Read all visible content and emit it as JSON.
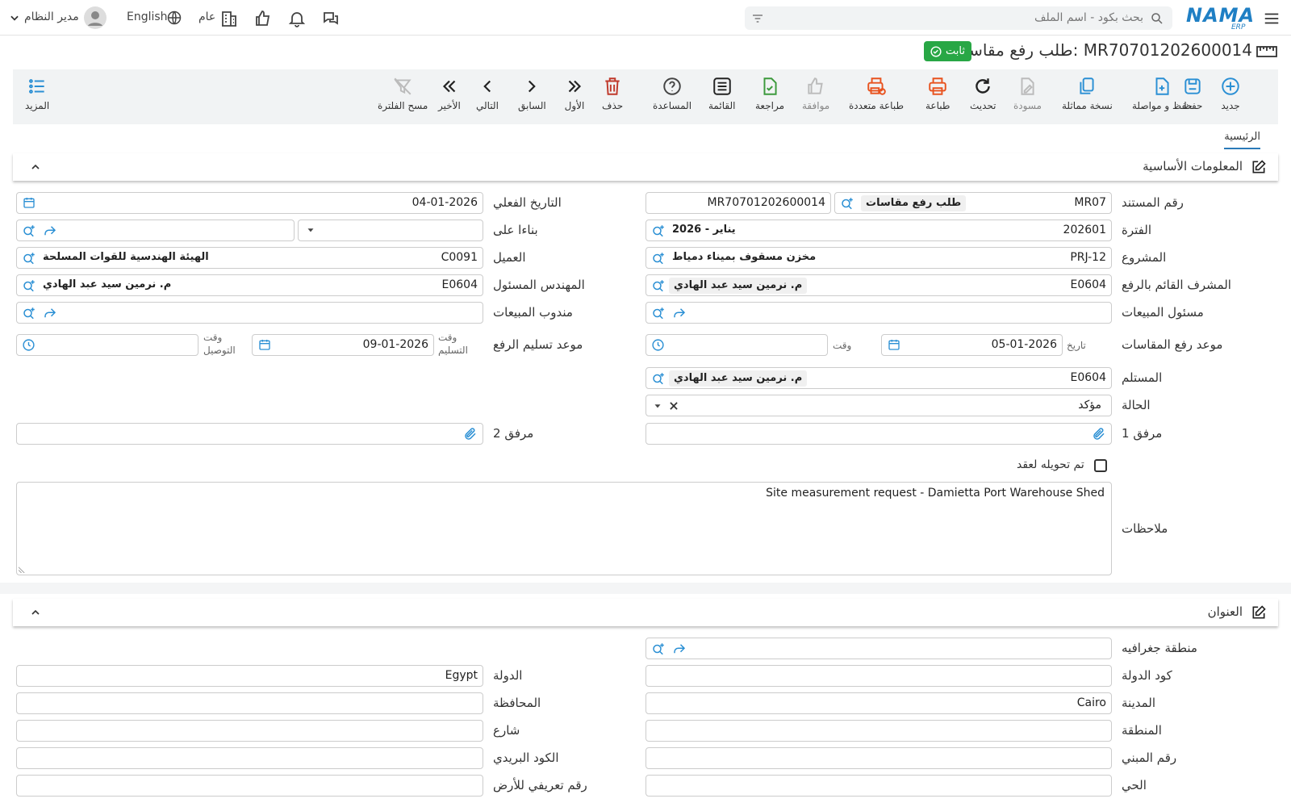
{
  "topbar": {
    "search_placeholder": "بحث بكود - اسم الملف",
    "logo_text": "NAMA",
    "logo_sub": "ERP",
    "language": "English",
    "branch": "عام",
    "user": "مدير النظام"
  },
  "page": {
    "title": "طلب رفع مقاسات: MR70701202600014",
    "status_badge": "ثابت"
  },
  "toolbar": {
    "new": "جديد",
    "save": "حفظ",
    "save_continue": "حفظ و مواصلة",
    "duplicate": "نسخة مماثلة",
    "draft": "مسودة",
    "refresh": "تحديث",
    "print": "طباعة",
    "multi_print": "طباعة متعددة",
    "approve": "موافقة",
    "review": "مراجعة",
    "list": "القائمة",
    "help": "المساعدة",
    "delete": "حذف",
    "first": "الأول",
    "previous": "السابق",
    "next": "التالي",
    "last": "الأخير",
    "clear_filter": "مسح الفلترة",
    "more": "المزيد"
  },
  "tabs": {
    "main": "الرئيسية"
  },
  "basic_section": {
    "title": "المعلومات الأساسية",
    "doc_number_label": "رقم المستند",
    "doc_prefix": "MR07",
    "doc_type": "طلب رفع مقاسات",
    "doc_number": "MR70701202600014",
    "actual_date_label": "التاريخ الفعلي",
    "actual_date": "04-01-2026",
    "period_label": "الفترة",
    "period_code": "202601",
    "period_name": "2026 - يناير",
    "based_on_label": "بناءا على",
    "project_label": "المشروع",
    "project_code": "PRJ-12",
    "project_name": "مخزن مسقوف بميناء دمياط",
    "customer_label": "العميل",
    "customer_code": "C0091",
    "customer_name": "الهيئة الهندسية للقوات المسلحة",
    "supervisor_label": "المشرف القائم بالرفع",
    "supervisor_code": "E0604",
    "supervisor_name": "م. نرمين سيد عبد الهادي",
    "engineer_label": "المهندس المسئول",
    "engineer_code": "E0604",
    "engineer_name": "م. نرمين سيد عبد الهادي",
    "sales_manager_label": "مسئول المبيعات",
    "sales_rep_label": "مندوب المبيعات",
    "measure_date_label": "موعد رفع المقاسات",
    "date_small": "تاريخ",
    "measure_date": "05-01-2026",
    "time_small": "وقت",
    "delivery_date_label": "موعد تسليم الرفع",
    "delivery_time_small": "وقت التسليم",
    "delivery_date": "09-01-2026",
    "arrival_time_small": "وقت التوصيل",
    "receiver_label": "المستلم",
    "receiver_code": "E0604",
    "receiver_name": "م. نرمين سيد عبد الهادي",
    "status_label": "الحالة",
    "status_value": "مؤكد",
    "attachment1_label": "مرفق 1",
    "attachment2_label": "مرفق 2",
    "converted_label": "تم تحويله لعقد",
    "notes_label": "ملاحظات",
    "notes": "Site measurement request - Damietta Port Warehouse Shed"
  },
  "address_section": {
    "title": "العنوان",
    "geo_region_label": "منطقة جغرافيه",
    "country_code_label": "كود الدولة",
    "country_label": "الدولة",
    "country": "Egypt",
    "city_label": "المدينة",
    "city": "Cairo",
    "governorate_label": "المحافظة",
    "area_label": "المنطقة",
    "street_label": "شارع",
    "building_label": "رقم المبني",
    "postal_label": "الكود البريدي",
    "district_label": "الحي",
    "land_id_label": "رقم تعريفي للأرض"
  },
  "colors": {
    "accent": "#2a8fd4",
    "success": "#28a745",
    "print": "#e8521e",
    "delete": "#c0392b",
    "review": "#3c9a3c"
  }
}
